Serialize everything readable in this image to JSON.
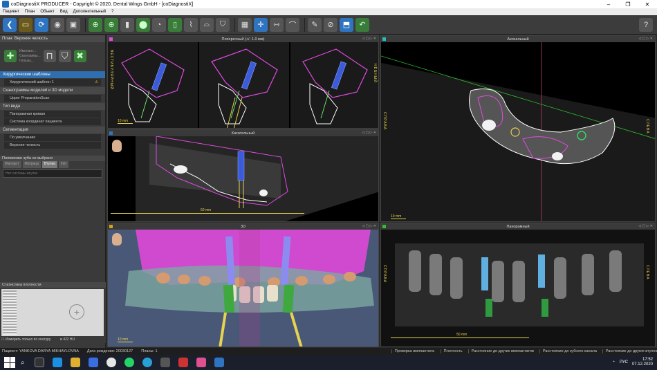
{
  "window": {
    "title": "coDiagnostiX PRODUCER - Copyright © 2020, Dental Wings GmbH - [coDiagnostiX]"
  },
  "menu": [
    "Пациент",
    "План",
    "Объект",
    "Вид",
    "Дополнительный",
    "?"
  ],
  "left_panel": {
    "plan_header": "План: Верхняя челюсть",
    "tool_list": [
      "Имплант...",
      "Скангаммы...",
      "Гильзы..."
    ],
    "sections": [
      {
        "title": "Хирургические шаблоны",
        "items": [
          {
            "label": "Хирургический шаблон 1",
            "warning": true
          }
        ]
      },
      {
        "title": "Сканограммы моделей и 3D модели",
        "items": [
          {
            "label": "Upper PreparationScan"
          }
        ]
      },
      {
        "title": "Тип вида",
        "items": [
          {
            "label": "Панорамная кривая"
          },
          {
            "label": "Система координат пациента"
          }
        ]
      },
      {
        "title": "Сегментация",
        "items": [
          {
            "label": "По умолчанию"
          },
          {
            "label": "Верхняя челюсть"
          }
        ]
      }
    ],
    "tooth_position": "Положение зуба не выбрано",
    "mini_tabs": [
      "Имплант",
      "Матрица",
      "Втулка",
      "Info"
    ],
    "active_mini_tab": "Втулка",
    "search_placeholder": "Нет системы втулок",
    "density_title": "Статистика плотности",
    "density_checkbox": "Измерить только по контуру",
    "density_value": "ø 422 HU",
    "density_min": "0 mm",
    "density_max": "2.5 mm"
  },
  "viewports": {
    "transverse": {
      "title": "Поперечный (+/- 1.0 мм)",
      "scale": "10 mm",
      "side_left": "ВЕСТИБУЛЯРНЫЙ",
      "side_right": "НЁБНЫЙ"
    },
    "tangential": {
      "title": "Касательный",
      "scale": "50 mm"
    },
    "axial": {
      "title": "Аксиальный",
      "scale": "10 mm",
      "side_left": "СПРАВА",
      "side_right": "СЛЕВА"
    },
    "threed": {
      "title": "3D",
      "scale": "10 mm"
    },
    "panoramic": {
      "title": "Панорамный",
      "scale": "50 mm",
      "side_left": "СПРАВА",
      "side_right": "СЛЕВА"
    }
  },
  "status": {
    "patient": "Пациент: YANKOVA DARYA MIKHAYLOVNA",
    "birth": "Дата рождения: 20030127",
    "plans": "Планы: 1",
    "right": [
      "Проверка имплантата:",
      "Плотность",
      "Расстояние до других имплантатов",
      "Расстояние до зубного канала",
      "Расстояние до других втулок"
    ]
  },
  "taskbar": {
    "lang": "РУС",
    "time": "17:52",
    "date": "07.12.2020"
  },
  "colors": {
    "accent": "#2f74c0",
    "scale": "#e6d350",
    "implant": "#3b5bd9",
    "outline": "#e04be0"
  }
}
